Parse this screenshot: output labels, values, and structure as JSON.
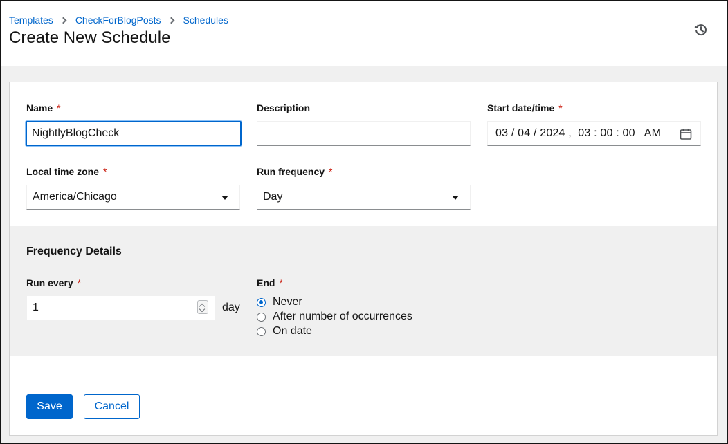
{
  "breadcrumb": [
    {
      "label": "Templates"
    },
    {
      "label": "CheckForBlogPosts"
    },
    {
      "label": "Schedules"
    }
  ],
  "page_title": "Create New Schedule",
  "header_icon": "history-icon",
  "form": {
    "name": {
      "label": "Name",
      "required": "*",
      "value": "NightlyBlogCheck"
    },
    "description": {
      "label": "Description",
      "value": ""
    },
    "start": {
      "label": "Start date/time",
      "required": "*",
      "value": "03 / 04 / 2024 ,  03 : 00 : 00   AM",
      "icon": "calendar-icon"
    },
    "timezone": {
      "label": "Local time zone",
      "required": "*",
      "value": "America/Chicago"
    },
    "frequency": {
      "label": "Run frequency",
      "required": "*",
      "value": "Day"
    }
  },
  "frequency_details": {
    "title": "Frequency Details",
    "run_every": {
      "label": "Run every",
      "required": "*",
      "value": "1",
      "unit": "day"
    },
    "end": {
      "label": "End",
      "required": "*",
      "options": [
        {
          "label": "Never",
          "checked": true
        },
        {
          "label": "After number of occurrences",
          "checked": false
        },
        {
          "label": "On date",
          "checked": false
        }
      ]
    }
  },
  "actions": {
    "save": "Save",
    "cancel": "Cancel"
  },
  "colors": {
    "primary": "#0066cc",
    "required": "#c9190b",
    "background": "#f0f0f0"
  }
}
